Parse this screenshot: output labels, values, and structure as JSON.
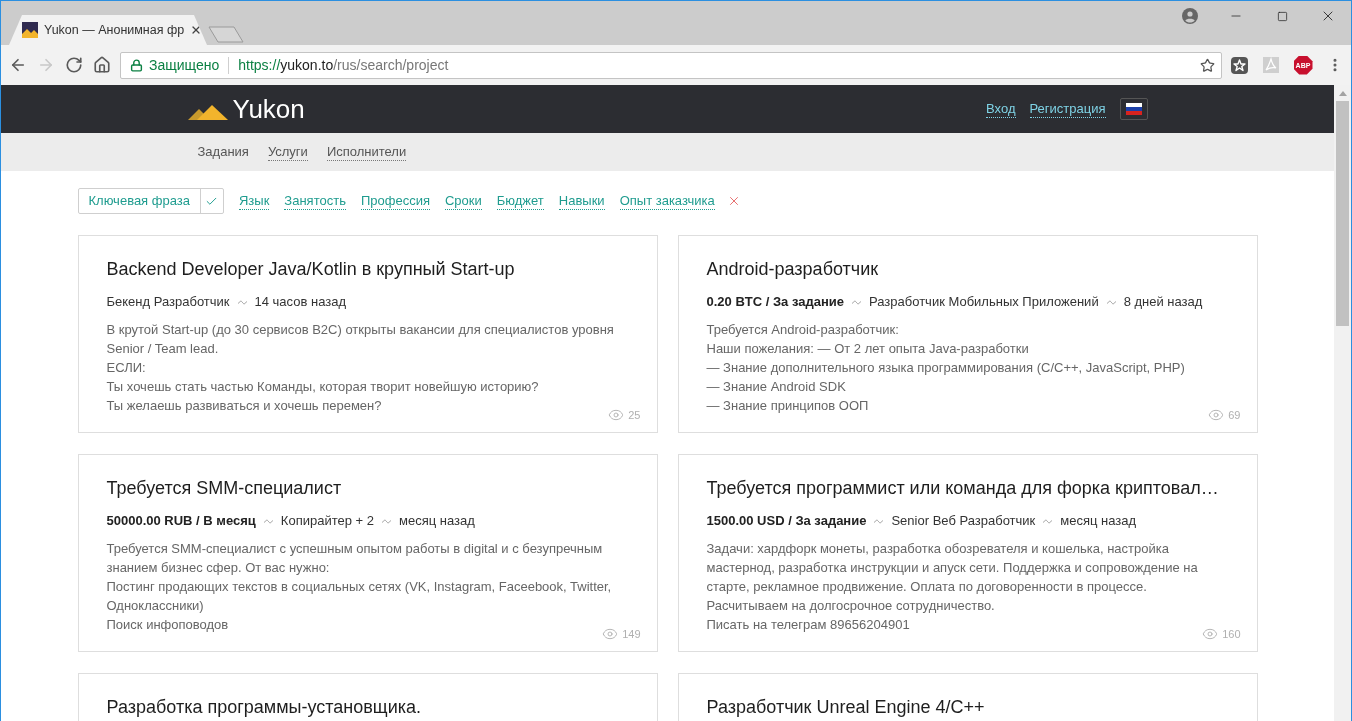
{
  "browser": {
    "tabs": [
      {
        "title": "Yukon — Анонимная фр",
        "selected": true
      }
    ],
    "toolbar": [
      {
        "kind": "back",
        "disabled": false
      },
      {
        "kind": "forward",
        "disabled": true
      },
      {
        "kind": "reload",
        "disabled": false
      },
      {
        "kind": "home",
        "disabled": false
      }
    ],
    "address": {
      "security": "Защищено",
      "scheme": "https://",
      "host": "yukon.to",
      "path": "/rus/search/project"
    },
    "extensions": [
      {
        "kind": "bookmark"
      },
      {
        "kind": "pdf"
      },
      {
        "kind": "adblock",
        "label": "ABP"
      }
    ]
  },
  "header": {
    "logo": "Yukon",
    "links": [
      "Вход",
      "Регистрация"
    ]
  },
  "nav": [
    {
      "label": "Задания",
      "selected": true
    },
    {
      "label": "Услуги",
      "selected": false
    },
    {
      "label": "Исполнители",
      "selected": false
    }
  ],
  "filters": {
    "keyword": "Ключевая фраза",
    "links": [
      "Язык",
      "Занятость",
      "Профессия",
      "Сроки",
      "Бюджет",
      "Навыки",
      "Опыт заказчика"
    ]
  },
  "projects": [
    {
      "title": "Backend Developer Java/Kotlin в крупный Start-up",
      "category": "Бекенд Разработчик",
      "time": "14 часов назад",
      "description": [
        "В крутой Start-up (до 30 сервисов B2C) открыты вакансии для специалистов уровня Senior / Team lead.",
        "ЕСЛИ:",
        "Ты хочешь стать частью Команды, которая творит новейшую историю?",
        "Ты желаешь развиваться и хочешь перемен?"
      ],
      "views": "25"
    },
    {
      "title": "Android-разработчик",
      "price": "0.20 BTC / За задание",
      "category": "Разработчик Мобильных Приложений",
      "time": "8 дней назад",
      "description": [
        "Требуется Android-разработчик:",
        "Наши пожелания: — От 2 лет опыта Java-разработки",
        "— Знание дополнительного языка программирования (C/C++, JavaScript, PHP)",
        "— Знание Android SDK",
        "— Знание принципов ООП"
      ],
      "views": "69"
    },
    {
      "title": "Требуется SMM-специалист",
      "price": "50000.00 RUB / В месяц",
      "category": "Копирайтер + 2",
      "time": "месяц назад",
      "description": [
        "Требуется SMM-специалист с успешным опытом работы в digital и с безупречным знанием бизнес сфер. От вас нужно:",
        "Постинг продающих текстов в социальных сетях (VK, Instagram, Faceebook, Twitter, Одноклассники)",
        "Поиск инфоповодов"
      ],
      "views": "149"
    },
    {
      "title": "Требуется программист или команда для форка криптовал…",
      "price": "1500.00 USD / За задание",
      "category": "Senior Веб Разработчик",
      "time": "месяц назад",
      "description": [
        "Задачи: хардфорк монеты, разработка обозревателя и кошелька, настройка мастернод, разработка инструкции и апуск сети. Поддержка и сопровождение на старте, рекламное продвижение. Оплата по договоренности в процессе.",
        "Расчитываем на долгосрочное сотрудничество.",
        "Писать на телеграм 89656204901"
      ],
      "views": "160"
    },
    {
      "title": "Разработка программы-установщика."
    },
    {
      "title": "Разработчик Unreal Engine 4/C++"
    }
  ]
}
